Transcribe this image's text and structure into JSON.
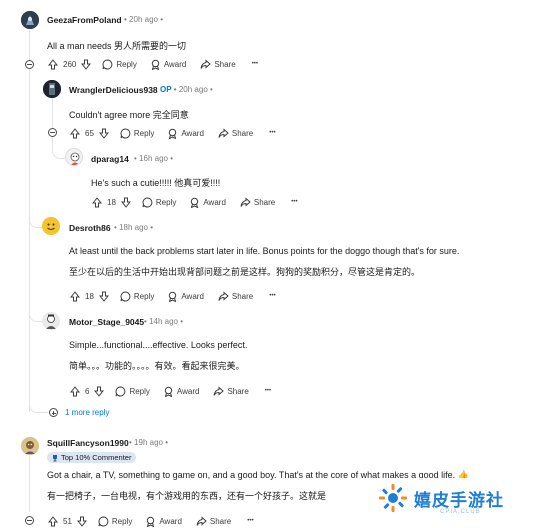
{
  "comments": [
    {
      "username": "GeezaFromPoland",
      "time": "20h ago",
      "dot": "•",
      "body": "All a man needs  男人所需要的一切",
      "votes": "260",
      "reply": "Reply",
      "award": "Award",
      "share": "Share",
      "more": "•••"
    },
    {
      "username": "WranglerDelicious938",
      "op": "OP",
      "time": "20h ago",
      "dot": "•",
      "body": "Couldn't agree more  完全同意",
      "votes": "65",
      "reply": "Reply",
      "award": "Award",
      "share": "Share",
      "more": "•••"
    },
    {
      "username": "dparag14",
      "time": "16h ago",
      "dot": "•",
      "body": "He's such a cutie!!!!!  他真可爱!!!!",
      "votes": "18",
      "reply": "Reply",
      "award": "Award",
      "share": "Share",
      "more": "•••"
    },
    {
      "username": "Desroth86",
      "time": "18h ago",
      "dot": "•",
      "body": "At least until the back problems start later in life. Bonus points for the doggo though that's for sure.",
      "body2": "至少在以后的生活中开始出现背部问题之前是这样。狗狗的奖励积分，尽管这是肯定的。",
      "votes": "18",
      "reply": "Reply",
      "award": "Award",
      "share": "Share",
      "more": "•••"
    },
    {
      "username": "Motor_Stage_9045",
      "time": "14h ago",
      "dot": "•",
      "body": "Simple...functional....effective. Looks perfect.",
      "body2": "简单。。。功能的。。。。有效。看起来很完美。",
      "votes": "6",
      "reply": "Reply",
      "award": "Award",
      "share": "Share",
      "more": "•••"
    },
    {
      "username": "SquillFancyson1990",
      "time": "19h ago",
      "dot": "•",
      "badge": "Top 10% Commenter",
      "body": "Got a chair, a TV, something to game on, and a good boy. That's at the core of what makes a good life. 👍",
      "body2": "有一把椅子，一台电视，有个游戏用的东西，还有一个好孩子。这就是",
      "votes": "51",
      "reply": "Reply",
      "award": "Award",
      "share": "Share",
      "more": "•••"
    }
  ],
  "more_reply": "1 more reply",
  "watermark": {
    "title": "嬉皮手游社",
    "sub": "CPIA.CLUB"
  }
}
